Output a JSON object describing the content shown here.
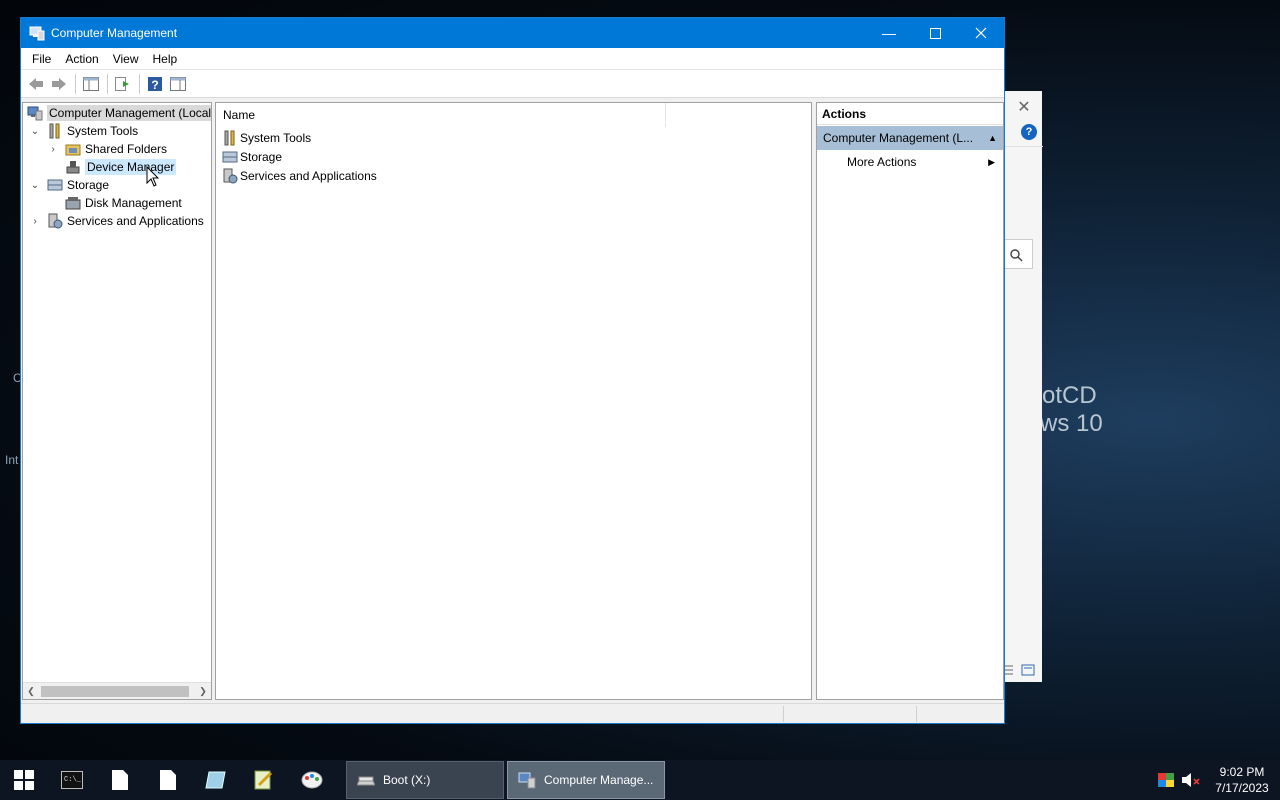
{
  "desktop": {
    "fragment_c": "C",
    "fragment_int": "Int",
    "watermark_line1": "otCD",
    "watermark_line2": "ws 10"
  },
  "window": {
    "title": "Computer Management",
    "menu": [
      "File",
      "Action",
      "View",
      "Help"
    ]
  },
  "tree": {
    "root": "Computer Management (Local",
    "items": [
      {
        "label": "System Tools",
        "icon": "tools-icon"
      },
      {
        "label": "Shared Folders",
        "icon": "shared-folders-icon"
      },
      {
        "label": "Device Manager",
        "icon": "device-manager-icon"
      },
      {
        "label": "Storage",
        "icon": "storage-icon"
      },
      {
        "label": "Disk Management",
        "icon": "disk-management-icon"
      },
      {
        "label": "Services and Applications",
        "icon": "services-icon"
      }
    ]
  },
  "list": {
    "column_name": "Name",
    "rows": [
      "System Tools",
      "Storage",
      "Services and Applications"
    ]
  },
  "actions": {
    "header": "Actions",
    "group": "Computer Management (L...",
    "more": "More Actions"
  },
  "taskbar": {
    "tasks": [
      "Boot (X:)",
      "Computer Manage..."
    ],
    "time": "9:02 PM",
    "date": "7/17/2023"
  },
  "colors": {
    "titlebar": "#0078d7",
    "selection": "#cce8ff",
    "actions_group": "#a7bfd6"
  }
}
